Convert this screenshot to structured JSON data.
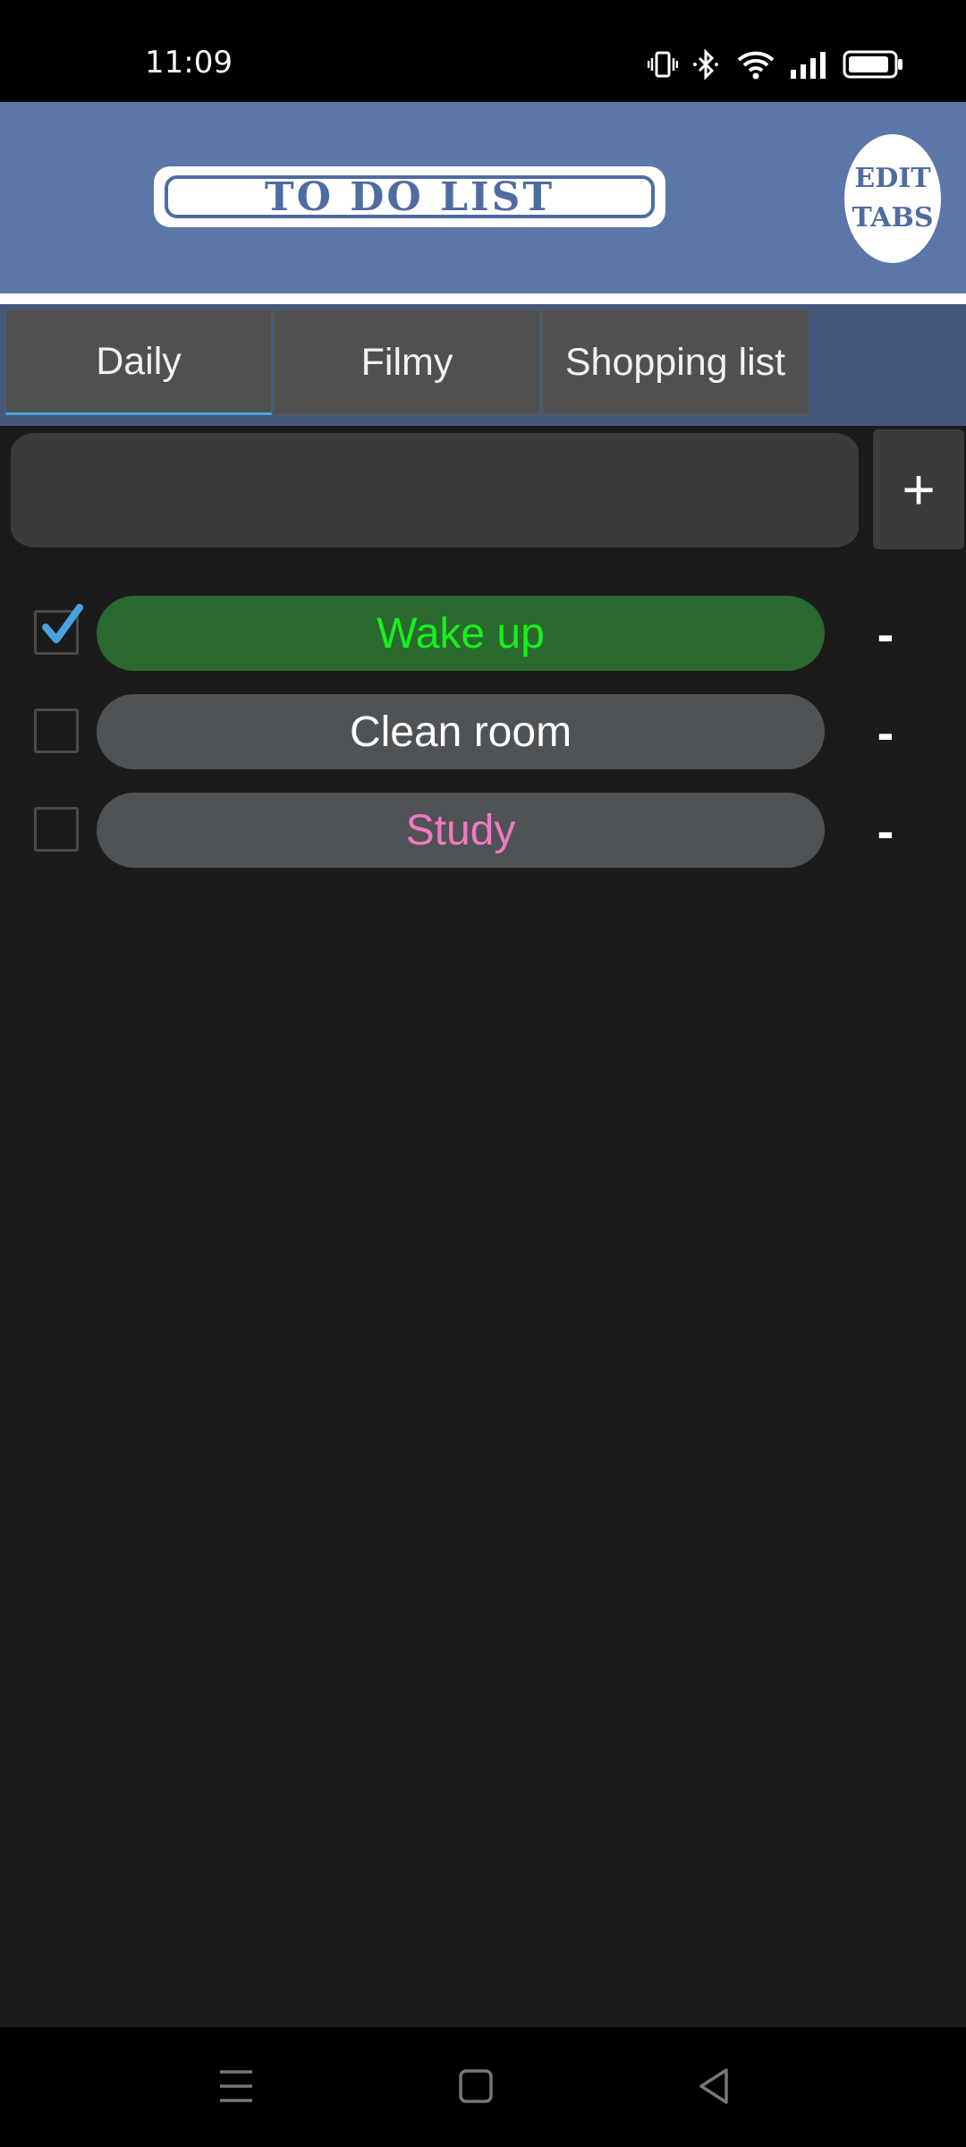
{
  "status_bar": {
    "time": "11:09",
    "icons": [
      "vibrate-icon",
      "bluetooth-icon",
      "wifi-icon",
      "signal-icon",
      "battery-icon"
    ]
  },
  "header": {
    "logo_text": "TO DO LIST",
    "edit_tabs_line1": "EDIT",
    "edit_tabs_line2": "TABS"
  },
  "tabs": [
    {
      "label": "Daily",
      "selected": true
    },
    {
      "label": "Filmy",
      "selected": false
    },
    {
      "label": "Shopping list",
      "selected": false
    }
  ],
  "add_row": {
    "input_value": "",
    "input_placeholder": "",
    "add_label": "+"
  },
  "items": [
    {
      "label": "Wake up",
      "checked": true,
      "text_color": "#19f01e",
      "bg_color": "#2a6a2e"
    },
    {
      "label": "Clean room",
      "checked": false,
      "text_color": "#ffffff",
      "bg_color": "#505356"
    },
    {
      "label": "Study",
      "checked": false,
      "text_color": "#f07ac4",
      "bg_color": "#505356"
    }
  ],
  "remove_label": "-",
  "colors": {
    "header_bg": "#5b76a7",
    "tab_bar_bg": "#45577a",
    "accent": "#4aa3df",
    "background": "#1b1b1b"
  },
  "nav_bar": [
    "menu-icon",
    "home-icon",
    "back-icon"
  ]
}
